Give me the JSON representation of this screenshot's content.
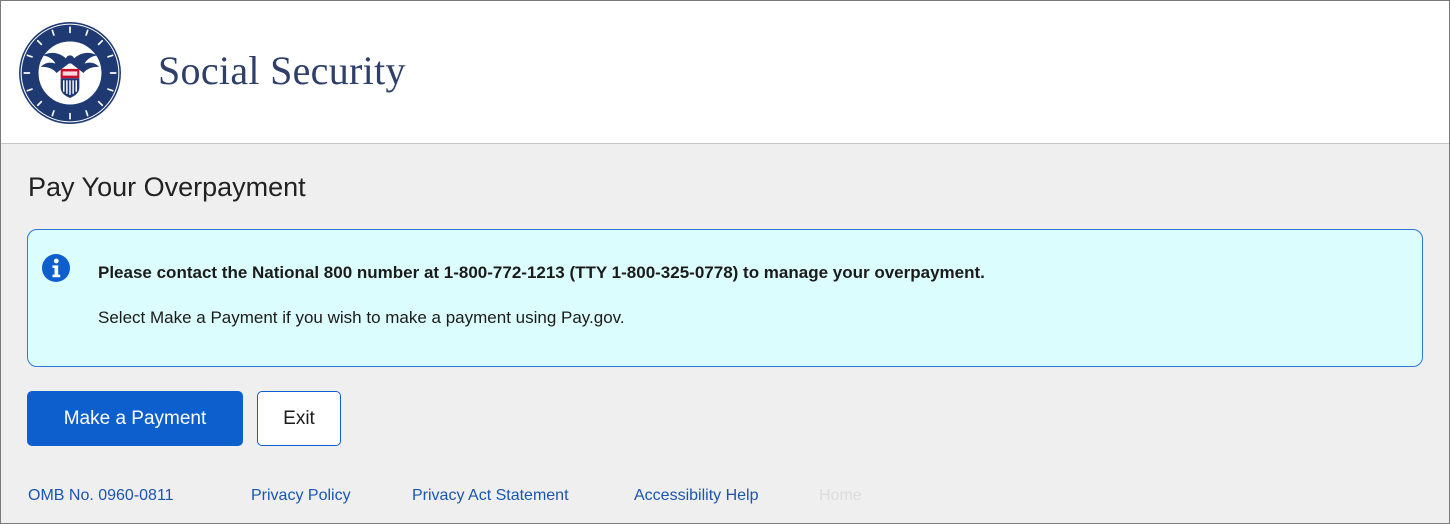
{
  "header": {
    "agency_name": "Social Security",
    "seal_icon": "ssa-seal-icon"
  },
  "main": {
    "page_title": "Pay Your Overpayment",
    "alert": {
      "icon": "info-icon",
      "title": "Please contact the National 800 number at 1-800-772-1213 (TTY 1-800-325-0778) to manage your overpayment.",
      "body": "Select Make a Payment if you wish to make a payment using Pay.gov."
    },
    "buttons": {
      "make_payment_label": "Make a Payment",
      "exit_label": "Exit"
    }
  },
  "footer": {
    "omb_number": "OMB No. 0960-0811",
    "links": {
      "privacy_policy": "Privacy Policy",
      "privacy_act_statement": "Privacy Act Statement",
      "accessibility_help": "Accessibility Help",
      "home": "Home"
    }
  },
  "colors": {
    "brand_navy": "#2e3f6a",
    "primary_blue": "#0c5fcd",
    "alert_background": "#dcfdfd",
    "alert_border": "#2e78d6",
    "link_blue": "#1a55b0",
    "page_background": "#efefef"
  }
}
